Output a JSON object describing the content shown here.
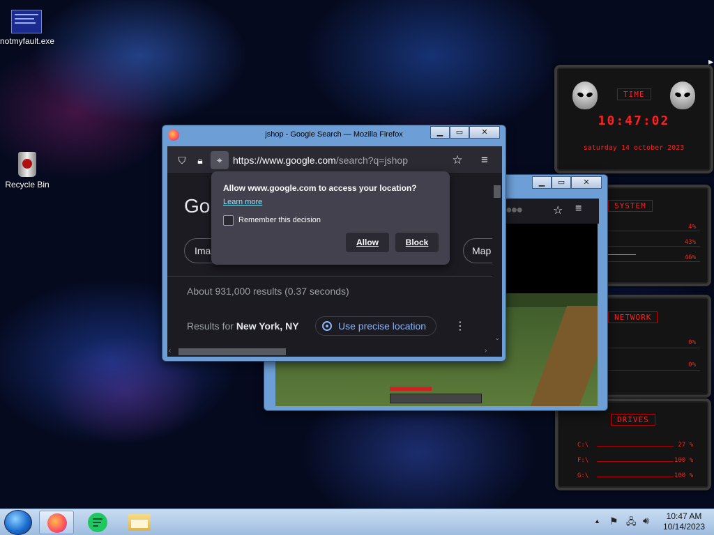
{
  "desktop": {
    "icons": [
      {
        "label": "notmyfault.exe",
        "icon": "notmyfault-exe-icon"
      },
      {
        "label": "Recycle Bin",
        "icon": "recycle-bin-icon"
      }
    ]
  },
  "widgets": {
    "time": {
      "header": "TIME",
      "clock": "10:47:02",
      "date": "saturday 14 october 2023"
    },
    "system": {
      "header": "SYSTEM",
      "values": [
        "4%",
        "43%",
        "46%"
      ]
    },
    "network": {
      "header": "NETWORK",
      "values": [
        "0%",
        "0%"
      ]
    },
    "drives": {
      "header": "DRIVES",
      "rows": [
        {
          "label": "C:\\",
          "value": "27 %"
        },
        {
          "label": "F:\\",
          "value": "100 %"
        },
        {
          "label": "G:\\",
          "value": "100 %"
        }
      ]
    }
  },
  "firefox": {
    "title": "jshop - Google Search — Mozilla Firefox",
    "url_host": "https://www.google.com",
    "url_path": "/search?q=jshop",
    "google_logo_partial": "Go",
    "chips": [
      "Imag",
      "Map"
    ],
    "results_stats": "About 931,000 results (0.37 seconds)",
    "results_for_prefix": "Results for ",
    "results_for_location": "New York, NY",
    "precise_location": "Use precise location",
    "popup": {
      "message": "Allow www.google.com to access your location?",
      "learn_more": "Learn more",
      "remember": "Remember this decision",
      "allow": "Allow",
      "block": "Block"
    }
  },
  "taskbar": {
    "time": "10:47 AM",
    "date": "10/14/2023"
  },
  "colors": {
    "accent_red": "#ff2020",
    "firefox_dark": "#1c1b22",
    "link_blue": "#8ab4f8",
    "taskbar": "#b4cdeb"
  }
}
